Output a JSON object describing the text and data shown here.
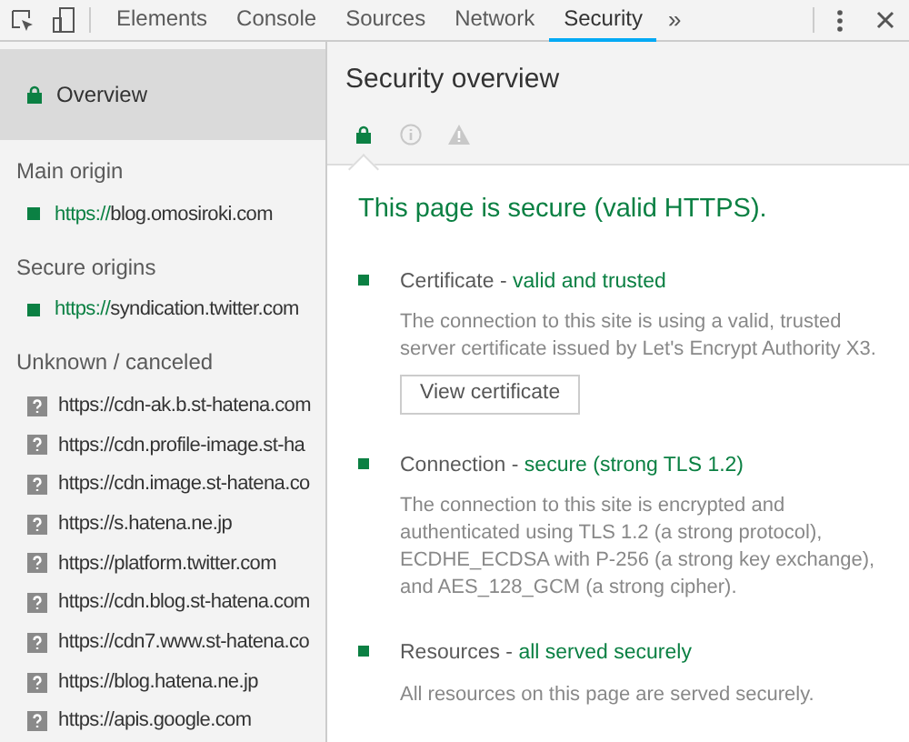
{
  "toolbar": {
    "tabs": [
      {
        "label": "Elements",
        "selected": false
      },
      {
        "label": "Console",
        "selected": false
      },
      {
        "label": "Sources",
        "selected": false
      },
      {
        "label": "Network",
        "selected": false
      },
      {
        "label": "Security",
        "selected": true
      }
    ],
    "more": "»"
  },
  "sidebar": {
    "overview": {
      "label": "Overview",
      "selected": true
    },
    "sections": [
      {
        "title": "Main origin",
        "items": [
          {
            "scheme": "https://",
            "host": "blog.omosiroki.com",
            "kind": "secure"
          }
        ]
      },
      {
        "title": "Secure origins",
        "items": [
          {
            "scheme": "https://",
            "host": "syndication.twitter.com",
            "kind": "secure"
          }
        ]
      },
      {
        "title": "Unknown / canceled",
        "items": [
          {
            "scheme": "https://",
            "host": "cdn-ak.b.st-hatena.com",
            "kind": "unknown"
          },
          {
            "scheme": "https://",
            "host": "cdn.profile-image.st-ha",
            "kind": "unknown"
          },
          {
            "scheme": "https://",
            "host": "cdn.image.st-hatena.co",
            "kind": "unknown"
          },
          {
            "scheme": "https://",
            "host": "s.hatena.ne.jp",
            "kind": "unknown"
          },
          {
            "scheme": "https://",
            "host": "platform.twitter.com",
            "kind": "unknown"
          },
          {
            "scheme": "https://",
            "host": "cdn.blog.st-hatena.com",
            "kind": "unknown"
          },
          {
            "scheme": "https://",
            "host": "cdn7.www.st-hatena.co",
            "kind": "unknown"
          },
          {
            "scheme": "https://",
            "host": "blog.hatena.ne.jp",
            "kind": "unknown"
          },
          {
            "scheme": "https://",
            "host": "apis.google.com",
            "kind": "unknown"
          }
        ]
      }
    ]
  },
  "main": {
    "title": "Security overview",
    "summary_icons": [
      {
        "kind": "secure",
        "selected": true
      },
      {
        "kind": "info",
        "selected": false
      },
      {
        "kind": "warning",
        "selected": false
      }
    ],
    "summary": "This page is secure (valid HTTPS).",
    "separator": " - ",
    "details": [
      {
        "name": "Certificate",
        "status": "valid and trusted",
        "description": "The connection to this site is using a valid, trusted server certificate issued by Let's Encrypt Authority X3.",
        "button": "View certificate"
      },
      {
        "name": "Connection",
        "status": "secure (strong TLS 1.2)",
        "description": "The connection to this site is encrypted and authenticated using TLS 1.2 (a strong protocol), ECDHE_ECDSA with P-256 (a strong key exchange), and AES_128_GCM (a strong cipher)."
      },
      {
        "name": "Resources",
        "status": "all served securely",
        "description": "All resources on this page are served securely."
      }
    ]
  }
}
